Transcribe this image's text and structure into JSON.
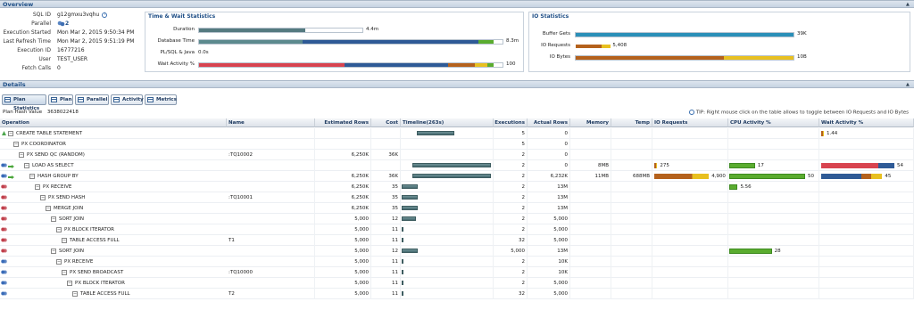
{
  "overview": {
    "title": "Overview",
    "fields": [
      {
        "key": "SQL ID",
        "value": "g12gmxu3vqhu"
      },
      {
        "key": "Parallel",
        "value": "2"
      },
      {
        "key": "Execution Started",
        "value": "Mon Mar 2, 2015 9:50:34 PM"
      },
      {
        "key": "Last Refresh Time",
        "value": "Mon Mar 2, 2015 9:51:19 PM"
      },
      {
        "key": "Execution ID",
        "value": "16777216"
      },
      {
        "key": "User",
        "value": "TEST_USER"
      },
      {
        "key": "Fetch Calls",
        "value": "0"
      }
    ]
  },
  "time_wait": {
    "title": "Time & Wait Statistics",
    "rows": [
      {
        "label": "Duration",
        "value": "4.4m"
      },
      {
        "label": "Database Time",
        "value": "8.3m"
      },
      {
        "label": "PL/SQL & Java",
        "value": "0.0s"
      },
      {
        "label": "Wait Activity %",
        "value": "100"
      }
    ]
  },
  "io_stats": {
    "title": "IO Statistics",
    "rows": [
      {
        "label": "Buffer Gets",
        "value": "39K"
      },
      {
        "label": "IO Requests",
        "value": "5,408"
      },
      {
        "label": "IO Bytes",
        "value": "10B"
      }
    ]
  },
  "details": {
    "title": "Details",
    "tabs": [
      "Plan Statistics",
      "Plan",
      "Parallel",
      "Activity",
      "Metrics"
    ],
    "plan_hash_label": "Plan Hash Value",
    "plan_hash_value": "3638022418",
    "tip": "TIP: Right mouse click on the table allows to toggle between IO Requests and IO Bytes",
    "columns": [
      "Operation",
      "Name",
      "Estimated Rows",
      "Cost",
      "Timeline(263s)",
      "Executions",
      "Actual Rows",
      "Memory",
      "Temp",
      "IO Requests",
      "CPU Activity %",
      "Wait Activity %"
    ],
    "rows": [
      {
        "op": "CREATE TABLE STATEMENT",
        "depth": 0,
        "name": "",
        "est": "",
        "cost": "",
        "tl": [
          0.17,
          0.58
        ],
        "exec": "5",
        "actual": "0",
        "mem": "",
        "temp": "",
        "io": "",
        "cpu": "",
        "wait": "1.44",
        "wait_pct": 1.44
      },
      {
        "op": "PX COORDINATOR",
        "depth": 1,
        "name": "",
        "est": "",
        "cost": "",
        "tl": null,
        "exec": "5",
        "actual": "0",
        "mem": "",
        "temp": "",
        "io": "",
        "cpu": "",
        "wait": ""
      },
      {
        "op": "PX SEND QC (RANDOM)",
        "depth": 2,
        "name": ":TQ10002",
        "est": "6,250K",
        "cost": "36K",
        "tl": null,
        "exec": "2",
        "actual": "0",
        "mem": "",
        "temp": "",
        "io": "",
        "cpu": "",
        "wait": ""
      },
      {
        "op": "LOAD AS SELECT",
        "depth": 3,
        "name": "",
        "est": "",
        "cost": "",
        "tl": [
          0.12,
          0.98
        ],
        "exec": "2",
        "actual": "0",
        "mem": "8MB",
        "temp": "",
        "io": "275",
        "io_pct": 5,
        "cpu": "17",
        "cpu_pct": 17,
        "wait": "54",
        "wait_pct": 54
      },
      {
        "op": "HASH GROUP BY",
        "depth": 4,
        "name": "",
        "est": "6,250K",
        "cost": "36K",
        "tl": [
          0.12,
          0.98
        ],
        "exec": "2",
        "actual": "6,232K",
        "mem": "11MB",
        "temp": "688MB",
        "io": "4,900",
        "io_pct": 90,
        "cpu": "50",
        "cpu_pct": 50,
        "wait": "45",
        "wait_pct": 45
      },
      {
        "op": "PX RECEIVE",
        "depth": 5,
        "name": "",
        "est": "6,250K",
        "cost": "35",
        "tl": [
          0.0,
          0.18
        ],
        "exec": "2",
        "actual": "13M",
        "mem": "",
        "temp": "",
        "io": "",
        "cpu": "5.56",
        "cpu_pct": 5.56,
        "wait": ""
      },
      {
        "op": "PX SEND HASH",
        "depth": 6,
        "name": ":TQ10001",
        "est": "6,250K",
        "cost": "35",
        "tl": [
          0.0,
          0.18
        ],
        "exec": "2",
        "actual": "13M",
        "mem": "",
        "temp": "",
        "io": "",
        "cpu": "",
        "wait": ""
      },
      {
        "op": "MERGE JOIN",
        "depth": 7,
        "name": "",
        "est": "6,250K",
        "cost": "35",
        "tl": [
          0.0,
          0.18
        ],
        "exec": "2",
        "actual": "13M",
        "mem": "",
        "temp": "",
        "io": "",
        "cpu": "",
        "wait": ""
      },
      {
        "op": "SORT JOIN",
        "depth": 8,
        "name": "",
        "est": "5,000",
        "cost": "12",
        "tl": [
          0.0,
          0.16
        ],
        "exec": "2",
        "actual": "5,000",
        "mem": "",
        "temp": "",
        "io": "",
        "cpu": "",
        "wait": ""
      },
      {
        "op": "PX BLOCK ITERATOR",
        "depth": 9,
        "name": "",
        "est": "5,000",
        "cost": "11",
        "tl": [
          0.0,
          0.01
        ],
        "exec": "2",
        "actual": "5,000",
        "mem": "",
        "temp": "",
        "io": "",
        "cpu": "",
        "wait": ""
      },
      {
        "op": "TABLE ACCESS FULL",
        "depth": 10,
        "name": "T1",
        "est": "5,000",
        "cost": "11",
        "tl": [
          0.0,
          0.01
        ],
        "exec": "32",
        "actual": "5,000",
        "mem": "",
        "temp": "",
        "io": "",
        "cpu": "",
        "wait": ""
      },
      {
        "op": "SORT JOIN",
        "depth": 8,
        "name": "",
        "est": "5,000",
        "cost": "12",
        "tl": [
          0.0,
          0.18
        ],
        "exec": "5,000",
        "actual": "13M",
        "mem": "",
        "temp": "",
        "io": "",
        "cpu": "28",
        "cpu_pct": 28,
        "wait": ""
      },
      {
        "op": "PX RECEIVE",
        "depth": 9,
        "name": "",
        "est": "5,000",
        "cost": "11",
        "tl": [
          0.0,
          0.01
        ],
        "exec": "2",
        "actual": "10K",
        "mem": "",
        "temp": "",
        "io": "",
        "cpu": "",
        "wait": ""
      },
      {
        "op": "PX SEND BROADCAST",
        "depth": 10,
        "name": ":TQ10000",
        "est": "5,000",
        "cost": "11",
        "tl": [
          0.0,
          0.01
        ],
        "exec": "2",
        "actual": "10K",
        "mem": "",
        "temp": "",
        "io": "",
        "cpu": "",
        "wait": ""
      },
      {
        "op": "PX BLOCK ITERATOR",
        "depth": 11,
        "name": "",
        "est": "5,000",
        "cost": "11",
        "tl": [
          0.0,
          0.01
        ],
        "exec": "2",
        "actual": "5,000",
        "mem": "",
        "temp": "",
        "io": "",
        "cpu": "",
        "wait": ""
      },
      {
        "op": "TABLE ACCESS FULL",
        "depth": 12,
        "name": "T2",
        "est": "5,000",
        "cost": "11",
        "tl": [
          0.0,
          0.01
        ],
        "exec": "32",
        "actual": "5,000",
        "mem": "",
        "temp": "",
        "io": "",
        "cpu": "",
        "wait": ""
      }
    ]
  },
  "colors": {
    "accent": "#1e4e86",
    "cpu": "#5aac2f",
    "user_io": "#2e5a96",
    "concurrency": "#b4611c",
    "other_wait": "#e8c020",
    "application": "#d8434f",
    "timeline": "#557a80",
    "buffer": "#2a8fb8"
  }
}
